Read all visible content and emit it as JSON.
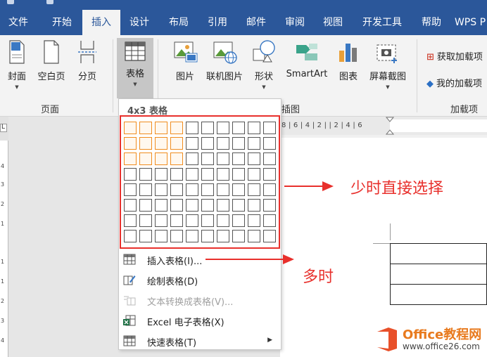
{
  "tabs": [
    "文件",
    "开始",
    "插入",
    "设计",
    "布局",
    "引用",
    "邮件",
    "审阅",
    "视图",
    "开发工具",
    "帮助",
    "WPS P"
  ],
  "active_tab": "插入",
  "ribbon": {
    "cover": "封面",
    "blank_page": "空白页",
    "page_break": "分页",
    "table": "表格",
    "picture": "图片",
    "online_picture": "联机图片",
    "shapes": "形状",
    "smartart": "SmartArt",
    "chart": "图表",
    "screenshot": "屏幕截图",
    "get_addins": "获取加载项",
    "my_addins": "我的加载项",
    "group_pages": "页面",
    "group_illustrations": "插图",
    "group_addins": "加载项"
  },
  "table_menu": {
    "grid_label": "4x3 表格",
    "grid_cols": 10,
    "grid_rows": 8,
    "selected_cols": 4,
    "selected_rows": 3,
    "items": [
      {
        "label": "插入表格(I)...",
        "icon": "table-icon",
        "enabled": true
      },
      {
        "label": "绘制表格(D)",
        "icon": "pencil-table-icon",
        "enabled": true
      },
      {
        "label": "文本转换成表格(V)...",
        "icon": "text-to-table-icon",
        "enabled": false
      },
      {
        "label": "Excel 电子表格(X)",
        "icon": "excel-icon",
        "enabled": true
      },
      {
        "label": "快速表格(T)",
        "icon": "quick-table-icon",
        "enabled": true,
        "submenu": true
      }
    ]
  },
  "ruler": {
    "horizontal": "8 | 6 | 4 | 2 |   | 2 | 4 | 6",
    "vertical": [
      "4",
      "3",
      "2",
      "1",
      "1",
      "1",
      "2",
      "3",
      "4",
      "5"
    ]
  },
  "annotations": {
    "few": "少时直接选择",
    "many": "多时"
  },
  "watermark": {
    "name": "Office教程网",
    "url": "www.office26.com"
  },
  "colors": {
    "accent": "#2b579a",
    "highlight": "#f08c1e",
    "annotation": "#e8302c"
  }
}
